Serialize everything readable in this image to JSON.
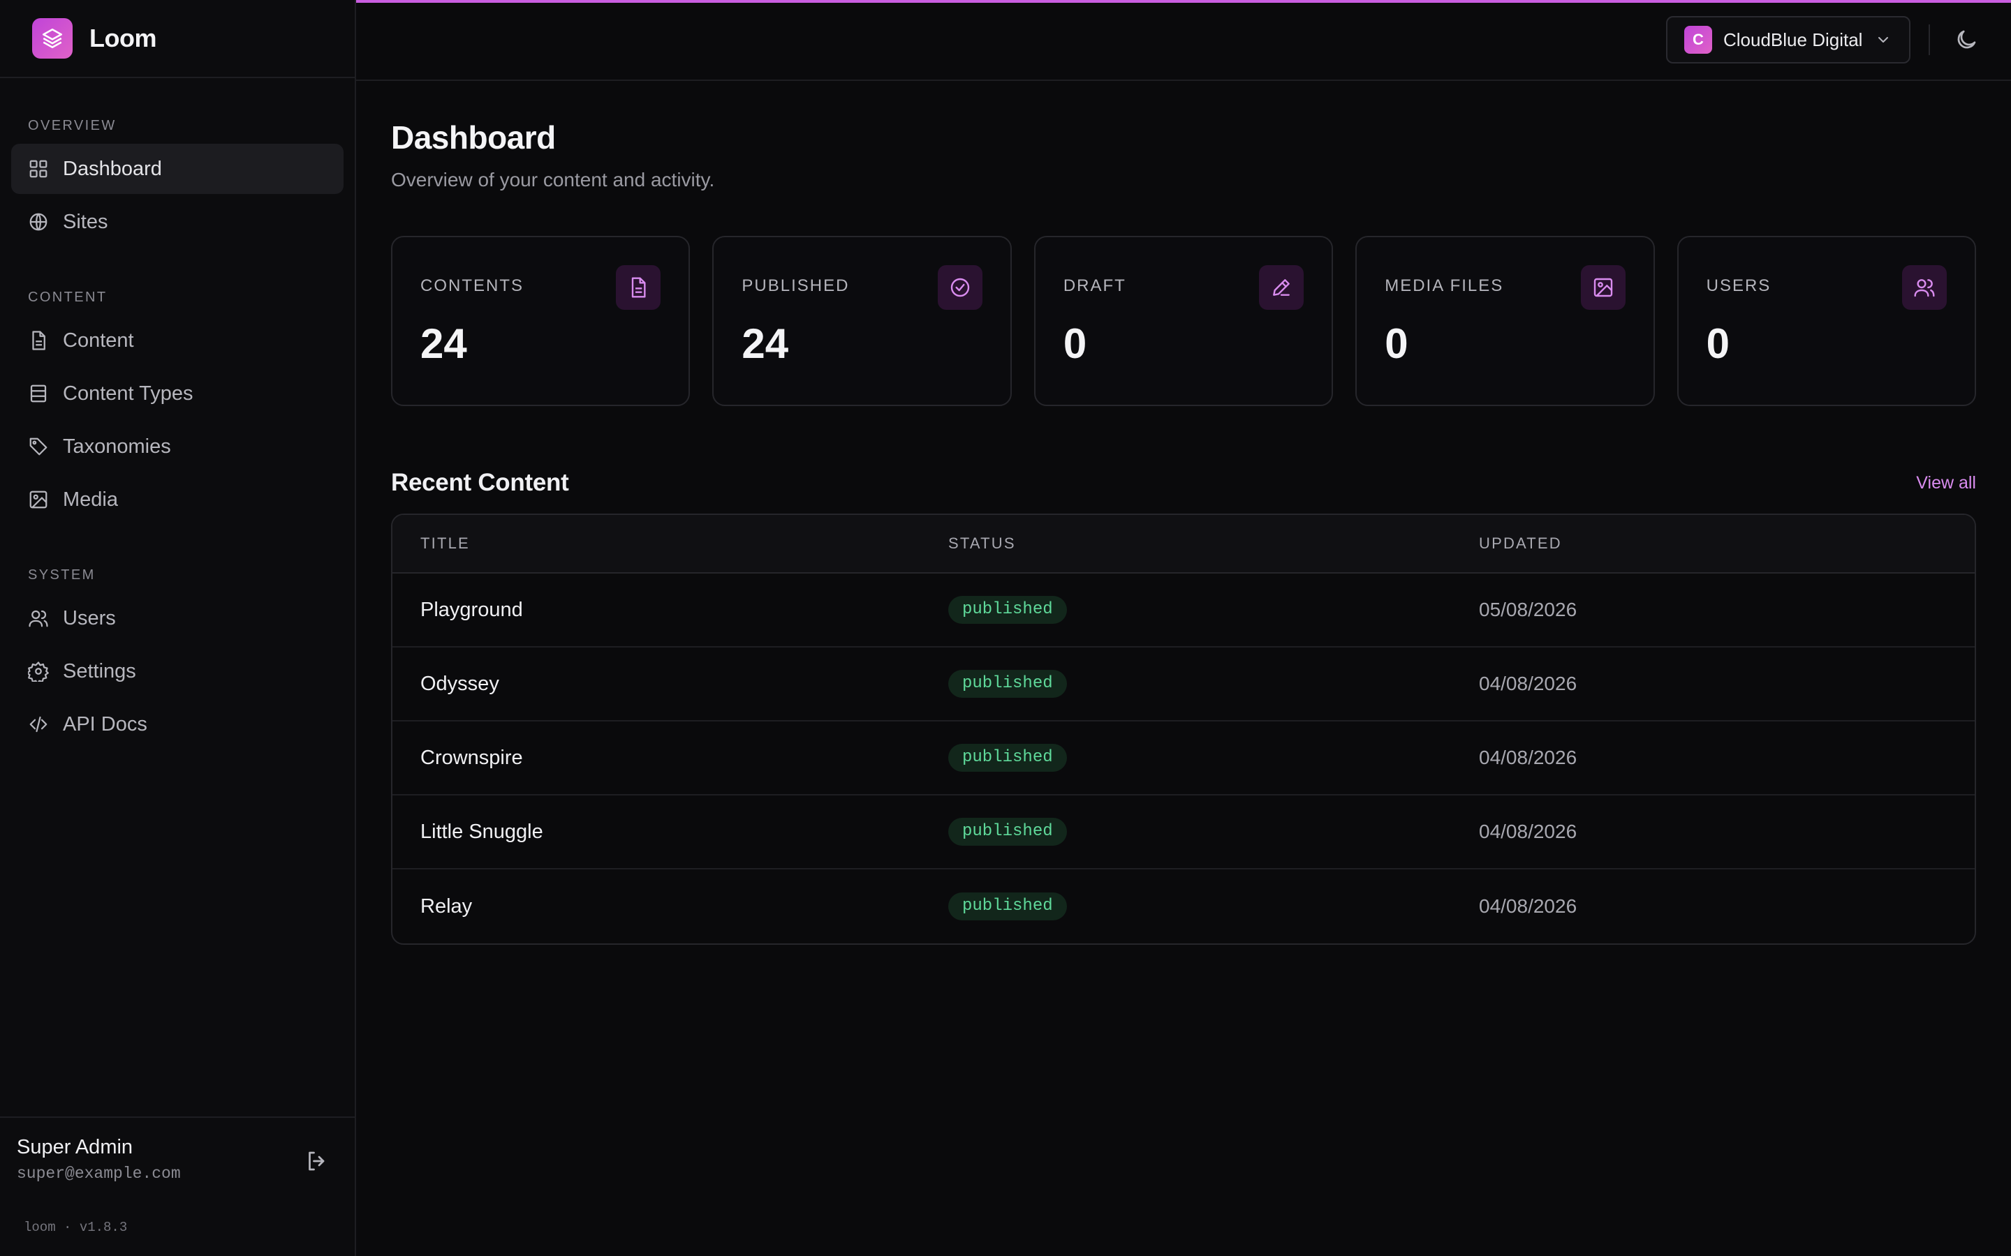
{
  "brand": {
    "name": "Loom"
  },
  "sidebar": {
    "sections": [
      {
        "label": "OVERVIEW",
        "items": [
          {
            "label": "Dashboard",
            "icon": "grid-icon",
            "active": true
          },
          {
            "label": "Sites",
            "icon": "globe-icon"
          }
        ]
      },
      {
        "label": "CONTENT",
        "items": [
          {
            "label": "Content",
            "icon": "file-icon"
          },
          {
            "label": "Content Types",
            "icon": "table-icon"
          },
          {
            "label": "Taxonomies",
            "icon": "tag-icon"
          },
          {
            "label": "Media",
            "icon": "image-icon"
          }
        ]
      },
      {
        "label": "SYSTEM",
        "items": [
          {
            "label": "Users",
            "icon": "users-icon"
          },
          {
            "label": "Settings",
            "icon": "gear-icon"
          },
          {
            "label": "API Docs",
            "icon": "code-icon"
          }
        ]
      }
    ],
    "user": {
      "name": "Super Admin",
      "email": "super@example.com"
    },
    "version": "loom · v1.8.3"
  },
  "topbar": {
    "site_initial": "C",
    "site_name": "CloudBlue Digital"
  },
  "page": {
    "title": "Dashboard",
    "subtitle": "Overview of your content and activity."
  },
  "stats": [
    {
      "label": "CONTENTS",
      "value": "24",
      "icon": "file-icon"
    },
    {
      "label": "PUBLISHED",
      "value": "24",
      "icon": "check-circle-icon"
    },
    {
      "label": "DRAFT",
      "value": "0",
      "icon": "pencil-icon"
    },
    {
      "label": "MEDIA FILES",
      "value": "0",
      "icon": "image-icon"
    },
    {
      "label": "USERS",
      "value": "0",
      "icon": "users-icon"
    }
  ],
  "recent": {
    "title": "Recent Content",
    "view_all": "View all",
    "columns": [
      "TITLE",
      "STATUS",
      "UPDATED"
    ],
    "rows": [
      {
        "title": "Playground",
        "status": "published",
        "updated": "05/08/2026"
      },
      {
        "title": "Odyssey",
        "status": "published",
        "updated": "04/08/2026"
      },
      {
        "title": "Crownspire",
        "status": "published",
        "updated": "04/08/2026"
      },
      {
        "title": "Little Snuggle",
        "status": "published",
        "updated": "04/08/2026"
      },
      {
        "title": "Relay",
        "status": "published",
        "updated": "04/08/2026"
      }
    ]
  },
  "colors": {
    "accent": "#c95ee0",
    "status_published": "#5fd99a",
    "background": "#0a0a0c"
  }
}
